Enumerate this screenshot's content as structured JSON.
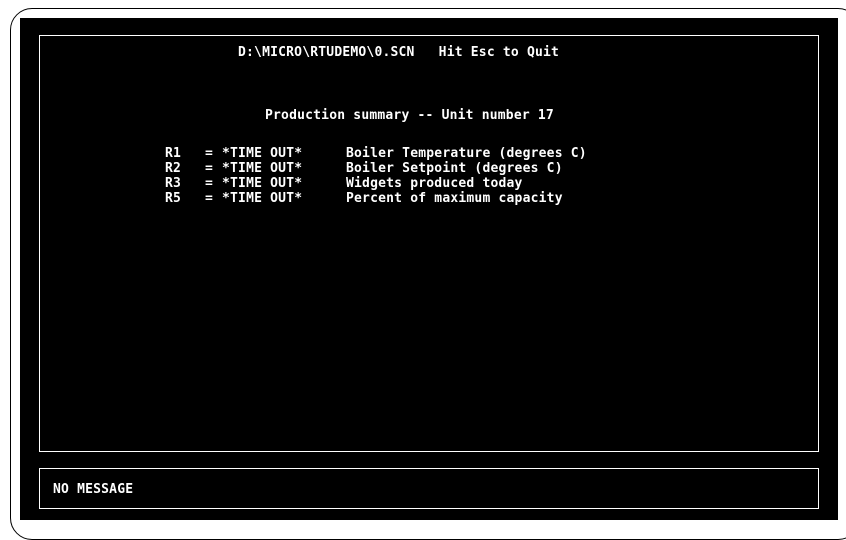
{
  "window": {
    "title": "D:\\MICRO\\RTUDEMO\\0.SCN   Hit Esc to Quit"
  },
  "screen": {
    "heading": "Production summary -- Unit number 17",
    "rows": [
      {
        "reg": "R1",
        "eq": "=",
        "value": "*TIME OUT*",
        "description": "Boiler Temperature (degrees C)"
      },
      {
        "reg": "R2",
        "eq": "=",
        "value": "*TIME OUT*",
        "description": "Boiler Setpoint (degrees C)"
      },
      {
        "reg": "R3",
        "eq": "=",
        "value": "*TIME OUT*",
        "description": "Widgets produced today"
      },
      {
        "reg": "R5",
        "eq": "=",
        "value": "*TIME OUT*",
        "description": "Percent of maximum capacity"
      }
    ]
  },
  "message_bar": {
    "text": "NO MESSAGE"
  }
}
